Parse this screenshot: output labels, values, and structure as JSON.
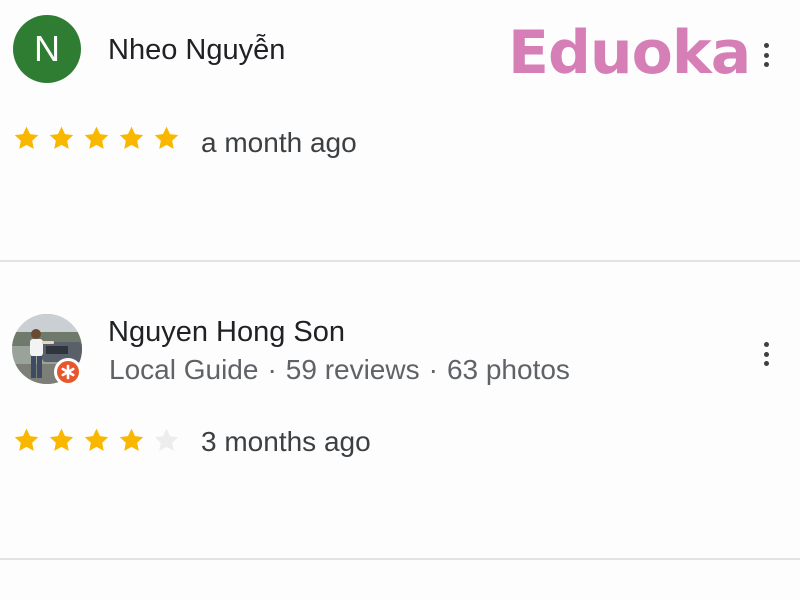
{
  "watermark": {
    "text": "Eduoka"
  },
  "colors": {
    "star_filled": "#f9b700",
    "star_empty": "#ededed",
    "avatar_bg": "#2e7d32",
    "guide_badge": "#e8572c"
  },
  "reviews": [
    {
      "avatar_letter": "N",
      "name": "Nheo Nguyễn",
      "rating": 5,
      "max_rating": 5,
      "time": "a month ago",
      "menu_icon": "more-vert-icon"
    },
    {
      "avatar_icon": "profile-photo",
      "local_guide_icon": "local-guide-badge-icon",
      "name": "Nguyen Hong Son",
      "guide_label": "Local Guide",
      "separator": "·",
      "reviews_count": "59 reviews",
      "photos_count": "63 photos",
      "rating": 4,
      "max_rating": 5,
      "time": "3 months ago",
      "menu_icon": "more-vert-icon"
    }
  ]
}
